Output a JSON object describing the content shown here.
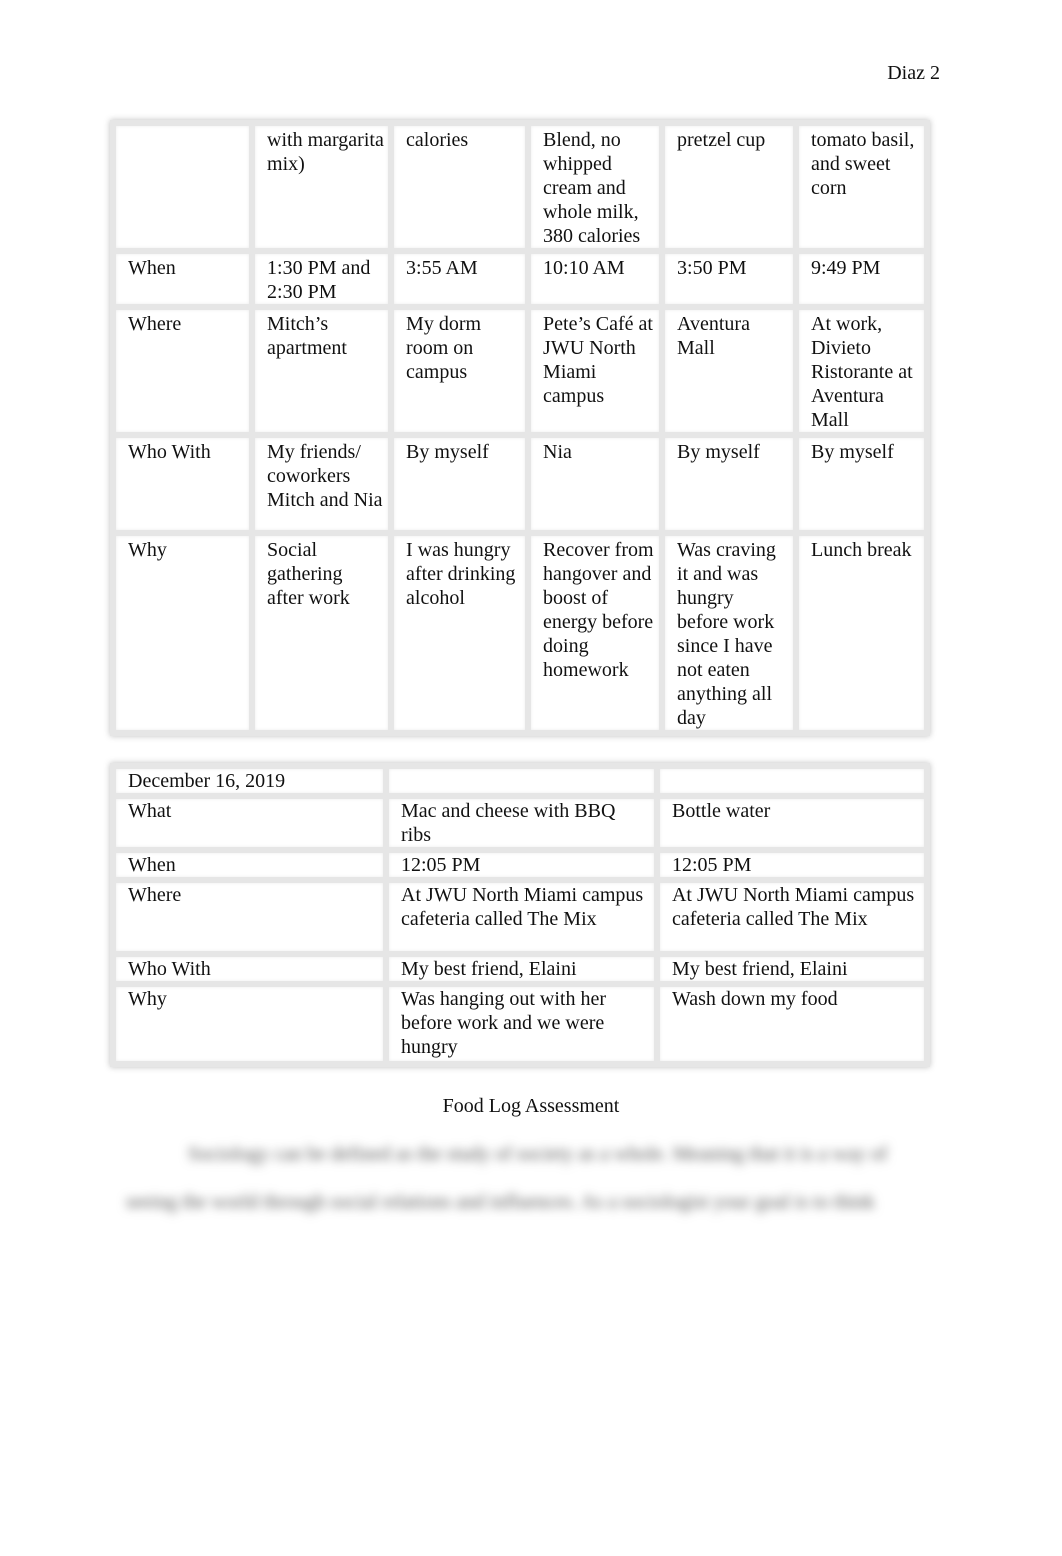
{
  "page": {
    "header": "Diaz 2"
  },
  "table1": {
    "rows": [
      {
        "label": "",
        "cells": [
          "with margarita mix)",
          "calories",
          "Blend, no whipped cream and whole milk, 380 calories",
          "pretzel cup",
          "tomato basil, and sweet corn"
        ]
      },
      {
        "label": "When",
        "cells": [
          "1:30 PM and 2:30 PM",
          "3:55 AM",
          "10:10 AM",
          "3:50 PM",
          "9:49 PM"
        ]
      },
      {
        "label": "Where",
        "cells": [
          "Mitch’s apartment",
          "My dorm room on campus",
          "Pete’s Café at JWU North Miami campus",
          "Aventura Mall",
          "At work, Divieto Ristorante at Aventura Mall"
        ]
      },
      {
        "label": "Who With",
        "cells": [
          "My friends/ coworkers Mitch and Nia",
          "By myself",
          "Nia",
          "By myself",
          "By myself"
        ]
      },
      {
        "label": "Why",
        "cells": [
          "Social gathering after work",
          "I was hungry after drinking alcohol",
          "Recover from hangover and boost of energy before doing homework",
          "Was craving it and was hungry before work since I have not eaten anything all day",
          "Lunch break"
        ]
      }
    ]
  },
  "table2": {
    "date": "December 16, 2019",
    "rows": [
      {
        "label": "What",
        "cells": [
          "Mac and cheese with BBQ ribs",
          "Bottle water"
        ]
      },
      {
        "label": "When",
        "cells": [
          "12:05 PM",
          "12:05 PM"
        ]
      },
      {
        "label": "Where",
        "cells": [
          "At JWU North Miami campus cafeteria called The Mix",
          "At JWU North Miami campus cafeteria called The Mix"
        ]
      },
      {
        "label": "Who With",
        "cells": [
          "My best friend, Elaini",
          "My best friend, Elaini"
        ]
      },
      {
        "label": "Why",
        "cells": [
          "Was hanging out with her before work and we were hungry",
          "Wash down my food"
        ]
      }
    ]
  },
  "assessment": {
    "title": "Food Log Assessment",
    "blurred_line1": "Sociology can be defined as the study of society as a whole. Meaning that it is a way of",
    "blurred_line2": "seeing the world through social relations and influences. As a sociologist your goal is to think"
  }
}
